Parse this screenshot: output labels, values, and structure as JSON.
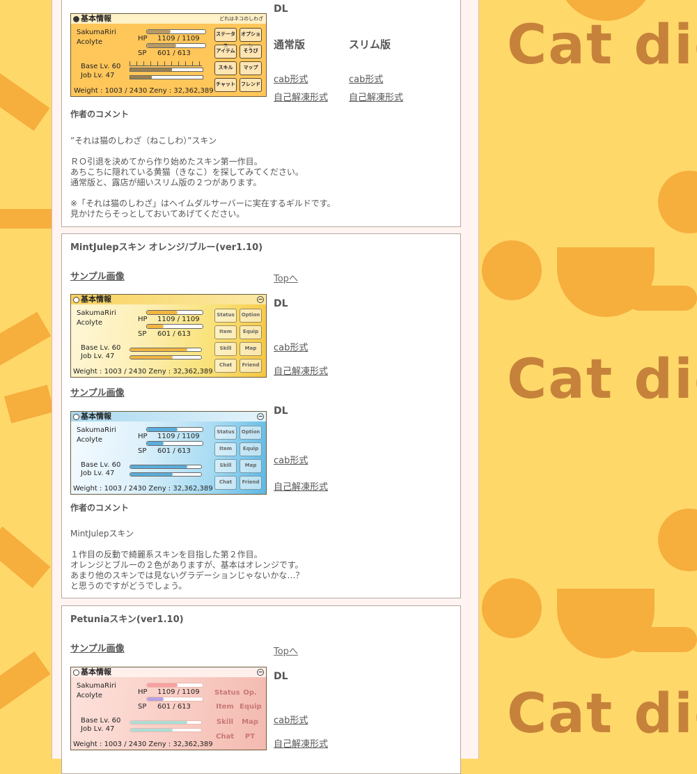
{
  "background": {
    "text": "Cat did"
  },
  "sections": {
    "first": {
      "dl_label": "DL",
      "versions": [
        "通常版",
        "スリム版"
      ],
      "links": {
        "normal_cab": "cab形式",
        "normal_exe": "自己解凍形式",
        "slim_cab": "cab形式",
        "slim_exe": "自己解凍形式"
      },
      "window": {
        "title": "基本情報",
        "brand": "どれはネコのしわざ",
        "name": "SakumaRiri",
        "job": "Acolyte",
        "hp_label": "HP",
        "hp": "1109  /  1109",
        "sp_label": "SP",
        "sp": "601  /  613",
        "base_lv": "Base Lv. 60",
        "job_lv": "Job Lv. 47",
        "footer": "Weight : 1003 / 2430    Zeny : 32,362,389",
        "buttons": [
          "ステータス",
          "オプション",
          "アイテム",
          "そうび",
          "スキル",
          "マップ",
          "チャット",
          "フレンド"
        ]
      },
      "comment_heading": "作者のコメント",
      "comment_lines": [
        "”それは猫のしわざ（ねこしわ）”スキン",
        "",
        "ＲＯ引退を決めてから作り始めたスキン第一作目。",
        "あちこちに隠れている黄猫（きなこ）を探してみてください。",
        "通常版と、露店が細いスリム版の２つがあります。",
        "",
        "※「それは猫のしわざ」はヘイムダルサーバーに実在するギルドです。",
        "見かけたらそっとしておいてあげてください。"
      ]
    },
    "mintjulep": {
      "title": "MintJulepスキン オレンジ/ブルー(ver1.10)",
      "sample_label": "サンプル画像",
      "top_link": "Topへ",
      "variants": [
        {
          "dl_label": "DL",
          "cab": "cab形式",
          "exe": "自己解凍形式"
        },
        {
          "sample_label": "サンプル画像",
          "dl_label": "DL",
          "cab": "cab形式",
          "exe": "自己解凍形式"
        }
      ],
      "window": {
        "title": "基本情報",
        "name": "SakumaRiri",
        "job": "Acolyte",
        "hp_label": "HP",
        "hp": "1109  /  1109",
        "sp_label": "SP",
        "sp": "601  /  613",
        "base_lv": "Base Lv. 60",
        "job_lv": "Job Lv. 47",
        "footer": "Weight : 1003 / 2430    Zeny : 32,362,389",
        "buttons": [
          "Status",
          "Option",
          "Item",
          "Equip",
          "Skill",
          "Map",
          "Chat",
          "Friend"
        ]
      },
      "comment_heading": "作者のコメント",
      "comment_lines": [
        "MintJulepスキン",
        "",
        "１作目の反動で綺麗系スキンを目指した第２作目。",
        "オレンジとブルーの２色がありますが、基本はオレンジです。",
        "あまり他のスキンでは見ないグラデーションじゃないかな…？",
        "と思うのですがどうでしょう。"
      ]
    },
    "petunia": {
      "title": "Petuniaスキン(ver1.10)",
      "sample_label": "サンプル画像",
      "top_link": "Topへ",
      "dl_label": "DL",
      "cab": "cab形式",
      "exe": "自己解凍形式",
      "window": {
        "title": "基本情報",
        "name": "SakumaRiri",
        "job": "Acolyte",
        "hp_label": "HP",
        "hp": "1109  /  1109",
        "sp_label": "SP",
        "sp": "601  /  613",
        "base_lv": "Base Lv. 60",
        "job_lv": "Job Lv. 47",
        "footer": "Weight : 1003 / 2430    Zeny : 32,362,389",
        "buttons": [
          "Status",
          "Op.",
          "Item",
          "Equip",
          "Skill",
          "Map",
          "Chat",
          "PT"
        ]
      }
    }
  }
}
